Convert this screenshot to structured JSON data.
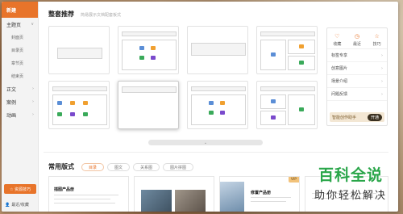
{
  "sidebar": {
    "new_label": "新建",
    "categories": [
      {
        "label": "主题页",
        "chev": "∨"
      },
      {
        "label": "正文",
        "chev": "›"
      },
      {
        "label": "案例",
        "chev": "›"
      },
      {
        "label": "动画",
        "chev": "›"
      }
    ],
    "sub_items": [
      "封面页",
      "目录页",
      "章节页",
      "结束页"
    ],
    "bottom_button": "☆ 资源技巧",
    "footer": "最近/收藏"
  },
  "section1": {
    "title": "整套推荐",
    "subtitle": "简易展示文档配套板式"
  },
  "right_panel": {
    "icons": [
      {
        "glyph": "♡",
        "label": "收藏"
      },
      {
        "glyph": "◷",
        "label": "最近"
      },
      {
        "glyph": "☆",
        "label": "技巧"
      }
    ],
    "rows": [
      "标签专享",
      "创意图片",
      "场景介绍",
      "问题反馈"
    ],
    "ai_label": "智能创作助手",
    "ai_button": "开通"
  },
  "scroll_hint": "⌄",
  "section2": {
    "title": "常用版式",
    "tabs": [
      "目录",
      "图文",
      "关系图",
      "图片拼图"
    ]
  },
  "cards": {
    "c1_title": "插图产品册",
    "c4_title": "修置产品册",
    "vip": "VIP"
  },
  "watermark": {
    "big": "百科全说",
    "small": "助你轻松解决"
  },
  "colors": {
    "accent": "#e8742a",
    "watermark_green": "#2aa64a"
  }
}
